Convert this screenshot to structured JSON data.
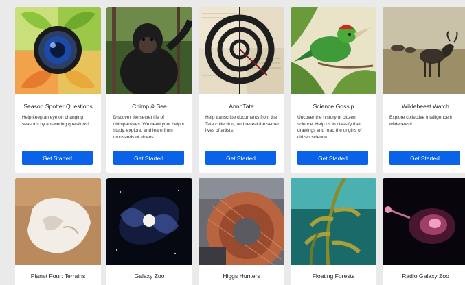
{
  "projects": [
    {
      "title": "Season Spotter Questions",
      "description": "Help keep an eye on changing seasons by answering questions!",
      "button_label": "Get Started",
      "icon": "camera-lens-leaves-image"
    },
    {
      "title": "Chimp & See",
      "description": "Discover the secret life of chimpanzees. We need your help to study, explore, and learn from thousands of videos.",
      "button_label": "Get Started",
      "icon": "chimpanzee-photo"
    },
    {
      "title": "AnnoTate",
      "description": "Help transcribe documents from the Tate collection, and reveal the secret lives of artists.",
      "button_label": "Get Started",
      "icon": "target-artwork-image"
    },
    {
      "title": "Science Gossip",
      "description": "Uncover the history of citizen science. Help us to classify their drawings and map the origins of citizen science.",
      "button_label": "Get Started",
      "icon": "bird-illustration-image"
    },
    {
      "title": "Wildebeest Watch",
      "description": "Explore collective intelligence in wildebeest!",
      "button_label": "Get Started",
      "icon": "wildebeest-photo"
    },
    {
      "title": "Planet Four: Terrains",
      "icon": "mars-polar-cap-image"
    },
    {
      "title": "Galaxy Zoo",
      "icon": "spiral-galaxy-image"
    },
    {
      "title": "Higgs Hunters",
      "icon": "particle-detector-photo"
    },
    {
      "title": "Floating Forests",
      "icon": "kelp-forest-photo"
    },
    {
      "title": "Radio Galaxy Zoo",
      "icon": "radio-galaxy-image"
    }
  ],
  "colors": {
    "page_background": "#eaeaea",
    "button": "#0a62e8",
    "button_text": "#ffffff"
  }
}
